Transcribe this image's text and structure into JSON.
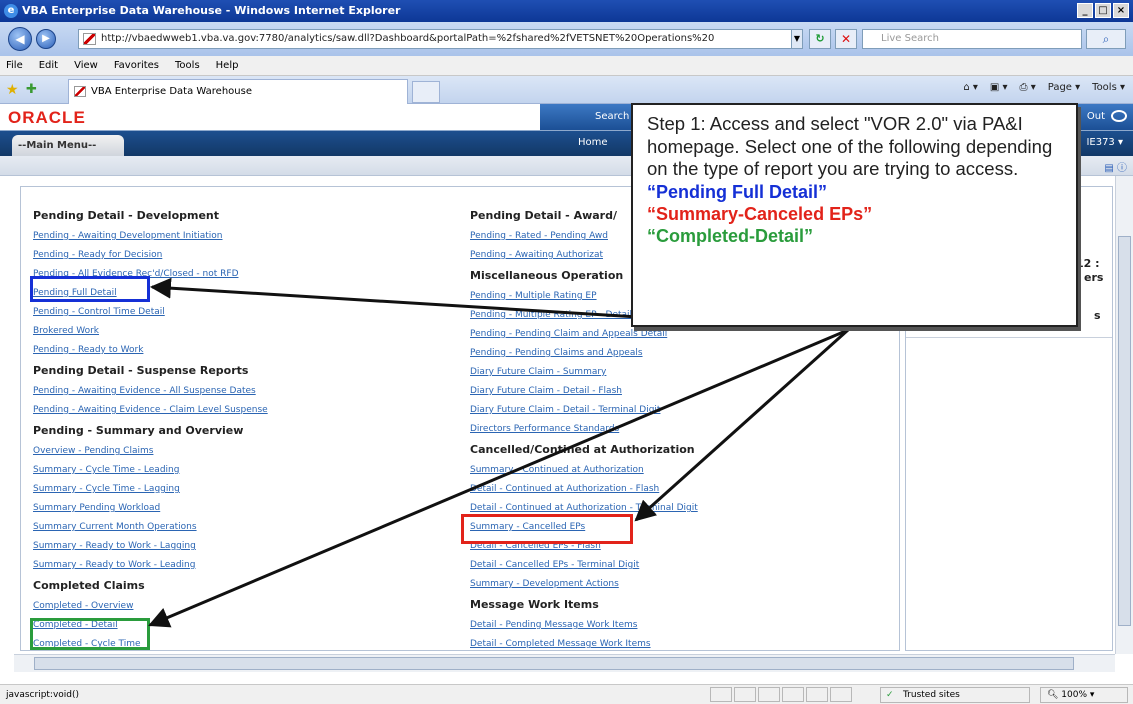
{
  "window": {
    "title": "VBA Enterprise Data Warehouse - Windows Internet Explorer"
  },
  "address_bar": {
    "url": "http://vbaedwweb1.vba.va.gov:7780/analytics/saw.dll?Dashboard&portalPath=%2fshared%2fVETSNET%20Operations%20",
    "search_placeholder": "Live Search"
  },
  "menu": [
    "File",
    "Edit",
    "View",
    "Favorites",
    "Tools",
    "Help"
  ],
  "tab": {
    "label": "VBA Enterprise Data Warehouse"
  },
  "command_bar": {
    "page": "Page",
    "tools": "Tools"
  },
  "oracle": {
    "logo": "ORACLE",
    "search": "Search",
    "sign_out_partial": "Out",
    "main_menu_tab": "Main Menu",
    "home": "Home",
    "user_partial": "IE373"
  },
  "left_column": [
    {
      "heading": "Pending Detail - Development",
      "links": [
        "Pending - Awaiting Development Initiation",
        "Pending - Ready for Decision",
        "Pending - All Evidence Rec'd/Closed - not RFD",
        "Pending Full Detail",
        "Pending - Control Time Detail",
        "Brokered Work",
        "Pending - Ready to Work"
      ]
    },
    {
      "heading": "Pending Detail - Suspense Reports",
      "links": [
        "Pending - Awaiting Evidence - All Suspense Dates",
        "Pending - Awaiting Evidence - Claim Level Suspense"
      ]
    },
    {
      "heading": "Pending - Summary and Overview",
      "links": [
        "Overview - Pending Claims",
        "Summary - Cycle Time - Leading",
        "Summary - Cycle Time - Lagging",
        "Summary Pending Workload",
        "Summary Current Month Operations",
        "Summary - Ready to Work - Lagging",
        "Summary - Ready to Work - Leading"
      ]
    },
    {
      "heading": "Completed Claims",
      "links": [
        "Completed - Overview",
        "Completed - Detail",
        "Completed - Cycle Time"
      ]
    }
  ],
  "middle_column": [
    {
      "heading": "Pending Detail - Award/",
      "links": [
        "Pending - Rated - Pending Awd",
        "Pending - Awaiting Authorizat"
      ]
    },
    {
      "heading": "Miscellaneous Operation",
      "links": [
        "Pending - Multiple Rating EP",
        "Pending - Multiple Rating EP - Detail",
        "Pending - Pending Claim and Appeals Detail",
        "Pending - Pending Claims and Appeals",
        "Diary Future Claim - Summary",
        "Diary Future Claim - Detail - Flash",
        "Diary Future Claim - Detail - Terminal Digit",
        "Directors Performance Standards"
      ]
    },
    {
      "heading": "Cancelled/Contined at Authorization",
      "links": [
        "Summary - Continued at Authorization",
        "Detail - Continued at Authorization - Flash",
        "Detail - Continued at Authorization - Terminal Digit",
        "Summary - Cancelled EPs",
        "Detail - Cancelled EPs - Flash",
        "Detail - Cancelled EPs - Terminal Digit",
        "Summary - Development Actions"
      ]
    },
    {
      "heading": "Message Work Items",
      "links": [
        "Detail - Pending Message Work Items",
        "Detail - Completed Message Work Items"
      ]
    }
  ],
  "right_panel": {
    "line1": "12 :",
    "line2": "ers",
    "line3": "s"
  },
  "callout": {
    "step": "Step 1: Access and select \"VOR 2.0\" via PA&I homepage. Select one of the following depending on the type of report you are trying to access.",
    "opt1": "“Pending Full Detail”",
    "opt2": "“Summary-Canceled EPs”",
    "opt3": "“Completed-Detail”"
  },
  "colors": {
    "opt1": "#1530d6",
    "opt2": "#e2231a",
    "opt3": "#2a9c3c",
    "link": "#2b65b3",
    "oracle_red": "#e2231a"
  },
  "status": {
    "left": "javascript:void()",
    "zone": "Trusted sites",
    "zoom": "100%"
  },
  "icons": [
    "ie-icon",
    "back-icon",
    "forward-icon",
    "refresh-icon",
    "stop-icon",
    "search-icon",
    "star-icon",
    "lock-icon"
  ]
}
